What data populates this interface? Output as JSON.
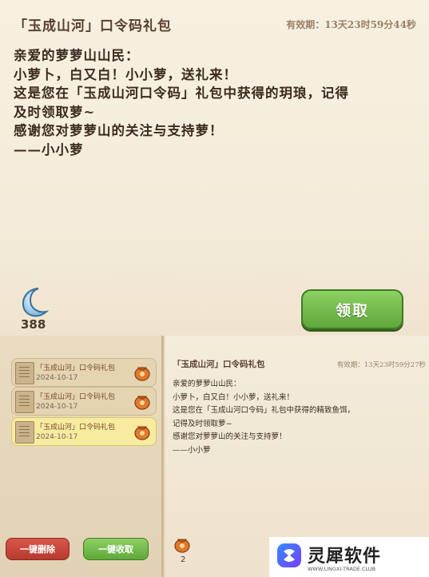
{
  "top_panel": {
    "title": "「玉成山河」口令码礼包",
    "expiry": "有效期：13天23时59分44秒",
    "body": "亲爱的萝萝山山民：\n小萝卜，白又白！小小萝，送礼来！\n这是您在「玉成山河口令码」礼包中获得的玥琅，记得\n及时领取萝~\n感谢您对萝萝山的关注与支持萝！\n——小小萝",
    "currency_icon": "crescent-moon-icon",
    "currency_count": "388",
    "claim_label": "领取"
  },
  "mail_list": {
    "items": [
      {
        "title": "「玉成山河」口令码礼包",
        "date": "2024-10-17",
        "selected": false
      },
      {
        "title": "「玉成山河」口令码礼包",
        "date": "2024-10-17",
        "selected": false
      },
      {
        "title": "「玉成山河」口令码礼包",
        "date": "2024-10-17",
        "selected": true
      }
    ],
    "delete_all_label": "一键删除",
    "collect_all_label": "一键收取",
    "bag_count": "2"
  },
  "mail_detail": {
    "title": "「玉成山河」口令码礼包",
    "expiry": "有效期：13天23时59分27秒",
    "body": "亲爱的萝萝山山民：\n小萝卜，白又白！小小萝，送礼来！\n这是您在「玉成山河口令码」礼包中获得的精致鱼饵，\n记得及时领取萝~\n感谢您对萝萝山的关注与支持萝！\n——小小萝"
  },
  "watermark": {
    "brand": "灵犀软件",
    "url": "WWW.LINGXI-TRADE.CLUB"
  },
  "colors": {
    "accent_green": "#5fa83a",
    "danger_red": "#b63a30",
    "paper": "#f4ecdb"
  }
}
